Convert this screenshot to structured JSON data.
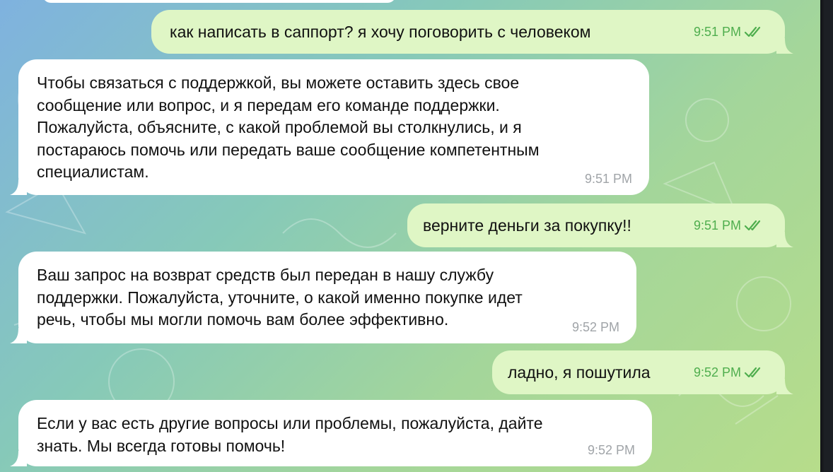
{
  "messages": [
    {
      "direction": "out",
      "text": "как написать в саппорт? я хочу поговорить с человеком",
      "time": "9:51 PM",
      "status": "read"
    },
    {
      "direction": "in",
      "text": "Чтобы связаться с поддержкой, вы можете оставить здесь свое\nсообщение или вопрос, и я передам его команде поддержки.\nПожалуйста, объясните, с какой проблемой вы столкнулись, и я\nпостараюсь помочь или передать ваше сообщение компетентным\nспециалистам.",
      "time": "9:51 PM"
    },
    {
      "direction": "out",
      "text": "верните деньги за покупку!!",
      "time": "9:51 PM",
      "status": "read"
    },
    {
      "direction": "in",
      "text": "Ваш запрос на возврат средств был передан в нашу службу\nподдержки. Пожалуйста, уточните, о какой именно покупке идет\nречь, чтобы мы могли помочь вам более эффективно.",
      "time": "9:52 PM"
    },
    {
      "direction": "out",
      "text": "ладно, я пошутила",
      "time": "9:52 PM",
      "status": "read"
    },
    {
      "direction": "in",
      "text": "Если у вас есть другие вопросы или проблемы, пожалуйста, дайте\nзнать. Мы всегда готовы помочь!",
      "time": "9:52 PM"
    }
  ],
  "icons": {
    "read_status": "double-check-icon"
  },
  "colors": {
    "outgoing_bubble": "#dff6c5",
    "incoming_bubble": "#ffffff",
    "outgoing_meta": "#4fae4e",
    "incoming_meta": "#a0a4a8"
  }
}
